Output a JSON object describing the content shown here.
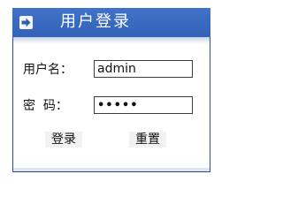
{
  "header": {
    "title": "用户登录",
    "icon": "arrow-right-icon"
  },
  "form": {
    "username_label": "用户名：",
    "username_value": "admin",
    "password_label": "密  码：",
    "password_value": "•••••"
  },
  "buttons": {
    "login_label": "登录",
    "reset_label": "重置"
  },
  "colors": {
    "header": "#3a6bc0",
    "border": "#2a4f9e"
  }
}
